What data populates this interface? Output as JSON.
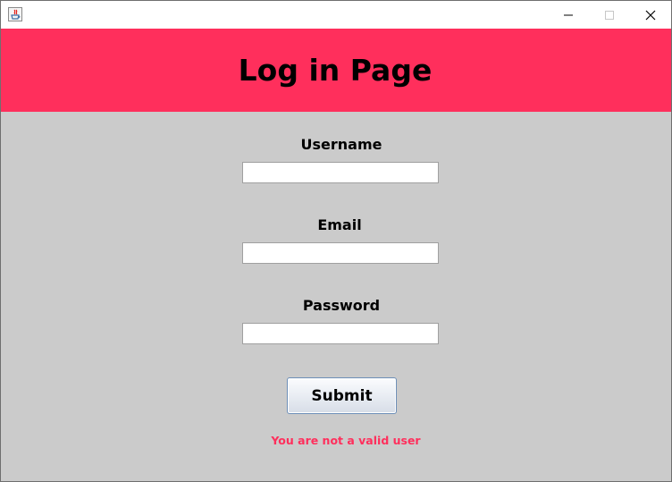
{
  "window": {
    "title": ""
  },
  "header": {
    "title": "Log in Page",
    "background_color": "#ff2f5c"
  },
  "form": {
    "username_label": "Username",
    "username_value": "",
    "email_label": "Email",
    "email_value": "",
    "password_label": "Password",
    "password_value": "",
    "submit_label": "Submit",
    "error_message": "You are not a valid user",
    "error_color": "#ff2f5c",
    "background_color": "#cbcbcb"
  },
  "icons": {
    "app": "java-icon",
    "minimize": "minimize-icon",
    "maximize": "maximize-icon",
    "close": "close-icon"
  }
}
